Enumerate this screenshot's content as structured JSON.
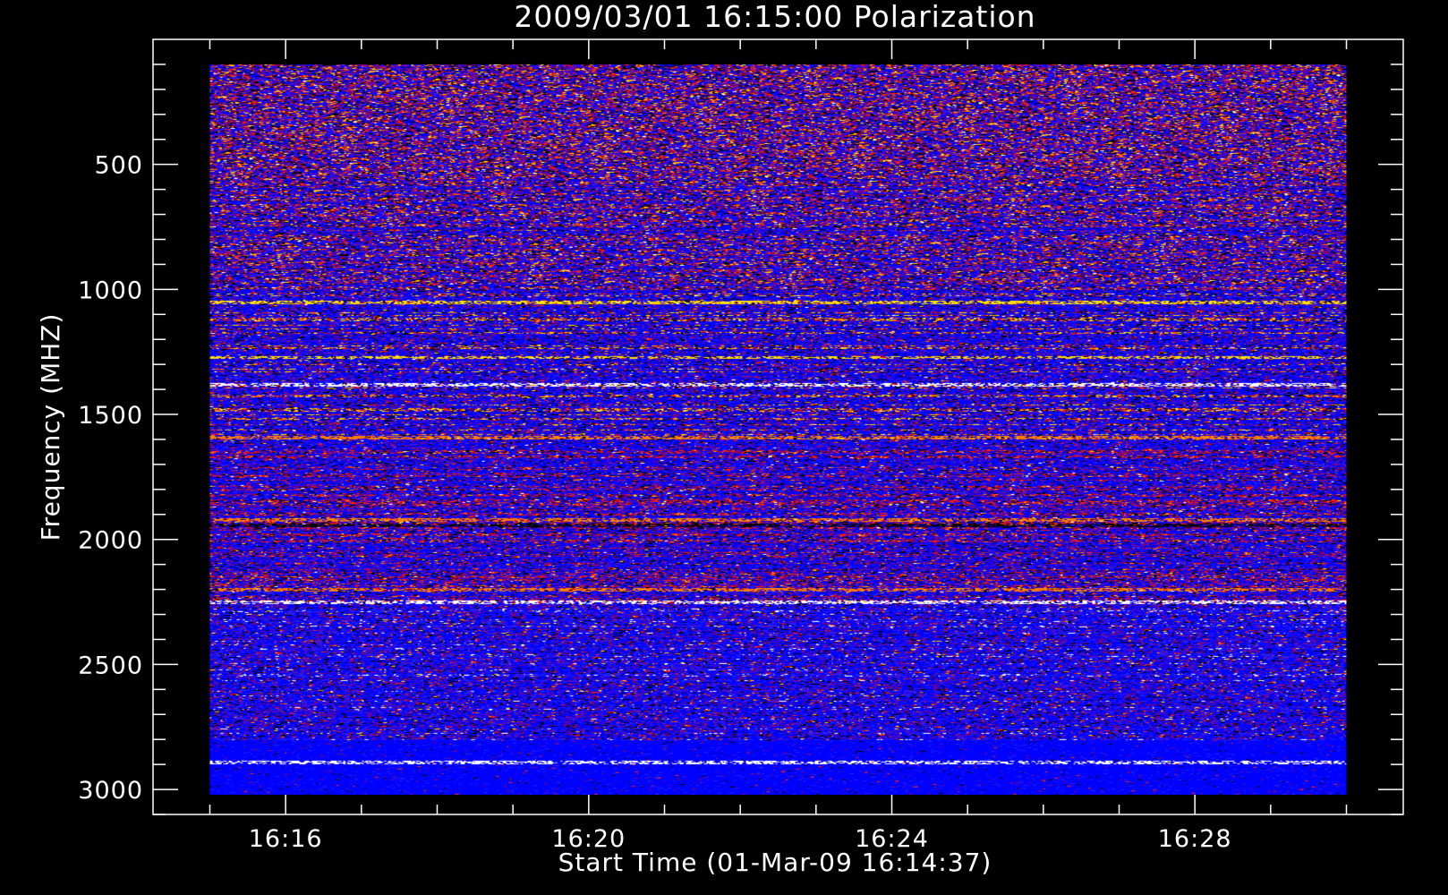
{
  "chart_data": {
    "type": "heatmap",
    "title": "2009/03/01 16:15:00 Polarization",
    "xlabel": "Start Time (01-Mar-09 16:14:37)",
    "ylabel": "Frequency (MHZ)",
    "x_tick_labels": [
      "16:16",
      "16:20",
      "16:24",
      "16:28"
    ],
    "x_tick_minutes": [
      16,
      20,
      24,
      28
    ],
    "x_axis_minutes_range": [
      14.25,
      30.75
    ],
    "x_data_minutes_range": [
      15,
      30
    ],
    "y_tick_labels": [
      "500",
      "1000",
      "1500",
      "2000",
      "2500",
      "3000"
    ],
    "y_tick_values": [
      500,
      1000,
      1500,
      2000,
      2500,
      3000
    ],
    "y_axis_range": [
      0,
      3100
    ],
    "y_data_range": [
      100,
      3020
    ],
    "y_reversed": true,
    "grid": false,
    "colormap": [
      "#000000",
      "#2020ff",
      "#0000ff",
      "#6a00a0",
      "#a00040",
      "#ff2000",
      "#ff8000",
      "#ffe000",
      "#ffffff"
    ],
    "notable_bands_mhz": [
      {
        "freq": 1050,
        "color": "#ffe000"
      },
      {
        "freq": 1270,
        "color": "#ffe000"
      },
      {
        "freq": 1380,
        "color": "#ffffff"
      },
      {
        "freq": 1590,
        "color": "#ff8000"
      },
      {
        "freq": 1920,
        "color": "#ff8000"
      },
      {
        "freq": 1940,
        "color": "#000000"
      },
      {
        "freq": 2200,
        "color": "#ff8000"
      },
      {
        "freq": 2250,
        "color": "#ffffff"
      },
      {
        "freq": 2890,
        "color": "#ffffff"
      }
    ]
  }
}
